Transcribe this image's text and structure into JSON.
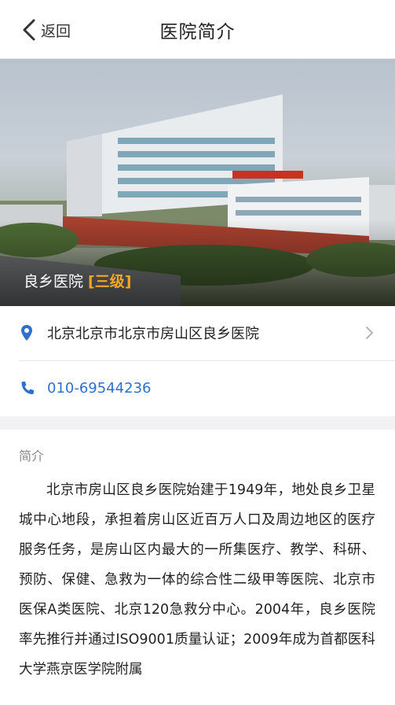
{
  "navbar": {
    "back_label": "返回",
    "title": "医院简介"
  },
  "hero": {
    "hospital_name": "良乡医院",
    "level": "[三级]"
  },
  "info": {
    "address": "北京北京市北京市房山区良乡医院",
    "phone": "010-69544236"
  },
  "intro": {
    "heading": "简介",
    "body": "北京市房山区良乡医院始建于1949年，地处良乡卫星城中心地段，承担着房山区近百万人口及周边地区的医疗服务任务，是房山区内最大的一所集医疗、教学、科研、预防、保健、急救为一体的综合性二级甲等医院、北京市医保A类医院、北京120急救分中心。2004年，良乡医院率先推行并通过ISO9001质量认证；2009年成为首都医科大学燕京医学院附属"
  },
  "colors": {
    "accent_blue": "#2f6fd0",
    "level_orange": "#f5a623"
  },
  "icons": [
    "back-arrow-icon",
    "location-pin-icon",
    "phone-icon",
    "chevron-right-icon"
  ]
}
